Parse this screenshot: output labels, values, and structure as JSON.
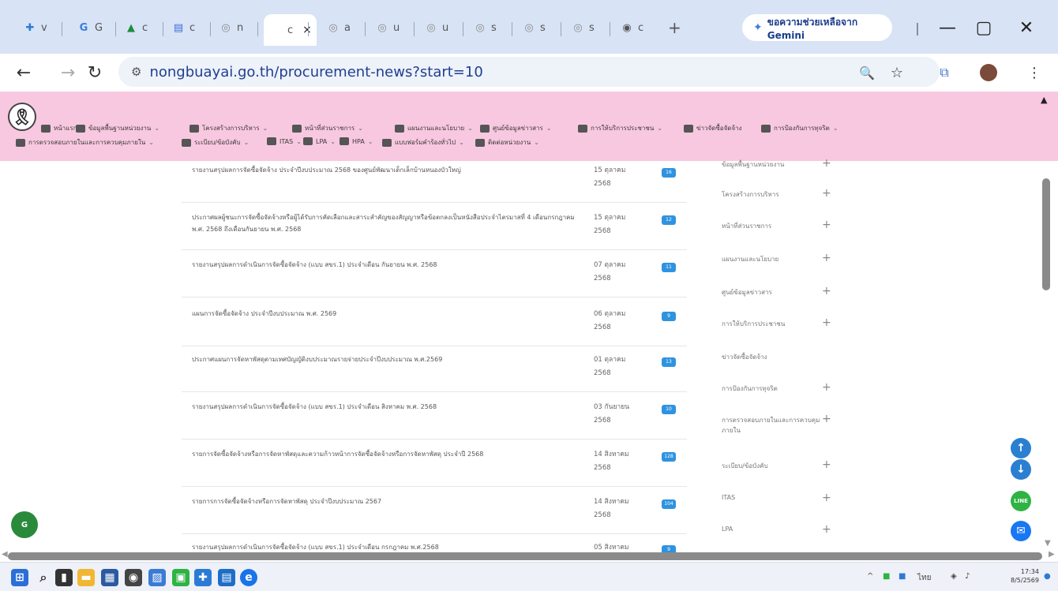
{
  "browser": {
    "tabs": [
      {
        "label": "v",
        "icon": "✚",
        "color": "#2b7bd4"
      },
      {
        "label": "G",
        "icon": "G",
        "color": "#3b7ddd"
      },
      {
        "label": "c",
        "icon": "▲",
        "color": "#1e8e3e"
      },
      {
        "label": "c",
        "icon": "▤",
        "color": "#3d6fd9"
      },
      {
        "label": "n",
        "icon": "◎",
        "color": "#8a8a8a"
      },
      {
        "label": "c",
        "icon": "",
        "color": "#8a8a8a"
      },
      {
        "label": "a",
        "icon": "◎",
        "color": "#8a8a8a"
      },
      {
        "label": "u",
        "icon": "◎",
        "color": "#8a8a8a"
      },
      {
        "label": "u",
        "icon": "◎",
        "color": "#8a8a8a"
      },
      {
        "label": "s",
        "icon": "◎",
        "color": "#8a8a8a"
      },
      {
        "label": "s",
        "icon": "◎",
        "color": "#8a8a8a"
      },
      {
        "label": "s",
        "icon": "◎",
        "color": "#8a8a8a"
      },
      {
        "label": "c",
        "icon": "◉",
        "color": "#555555"
      }
    ],
    "close_tab_glyph": "×",
    "new_tab_glyph": "+",
    "gemini_label": "ขอความช่วยเหลือจาก Gemini",
    "url": "nongbuayai.go.th/procurement-news?start=10"
  },
  "site_nav": {
    "row1": [
      {
        "label": "หน้าแรก",
        "caret": false
      },
      {
        "label": "ข้อมูลพื้นฐานหน่วยงาน",
        "caret": true
      },
      {
        "label": "โครงสร้างการบริหาร",
        "caret": true
      },
      {
        "label": "หน้าที่ส่วนราชการ",
        "caret": true
      },
      {
        "label": "แผนงานและนโยบาย",
        "caret": true
      },
      {
        "label": "ศูนย์ข้อมูลข่าวสาร",
        "caret": true
      },
      {
        "label": "การให้บริการประชาชน",
        "caret": true
      },
      {
        "label": "ข่าวจัดซื้อจัดจ้าง",
        "caret": false
      },
      {
        "label": "การป้องกันการทุจริต",
        "caret": true
      }
    ],
    "row2": [
      {
        "label": "การตรวจสอบภายในและการควบคุมภายใน",
        "caret": true
      },
      {
        "label": "ระเบียบ/ข้อบังคับ",
        "caret": true
      },
      {
        "label": "ITAS",
        "caret": true
      },
      {
        "label": "LPA",
        "caret": true
      },
      {
        "label": "HPA",
        "caret": true
      },
      {
        "label": "แบบฟอร์มคำร้องทั่วไป",
        "caret": true
      },
      {
        "label": "ติดต่อหน่วยงาน",
        "caret": true
      }
    ]
  },
  "news": [
    {
      "title": "รายงานสรุปผลการจัดซื้อจัดจ้าง ประจำปีงบประมาณ 2568 ของศูนย์พัฒนาเด็กเล็กบ้านหนองบัวใหญ่",
      "date": "15 ตุลาคม 2568",
      "badge": "16"
    },
    {
      "title": "ประกาศผลผู้ชนะการจัดซื้อจัดจ้างหรือผู้ได้รับการคัดเลือกและสาระสำคัญของสัญญาหรือข้อตกลงเป็นหนังสือประจำไตรมาสที่ 4 เดือนกรกฎาคม พ.ศ. 2568 ถึงเดือนกันยายน พ.ศ. 2568",
      "date": "15 ตุลาคม 2568",
      "badge": "12"
    },
    {
      "title": "รายงานสรุปผลการดำเนินการจัดซื้อจัดจ้าง (แบบ สขร.1) ประจำเดือน กันยายน พ.ศ. 2568",
      "date": "07 ตุลาคม 2568",
      "badge": "11"
    },
    {
      "title": "แผนการจัดซื้อจัดจ้าง ประจำปีงบประมาณ พ.ศ. 2569",
      "date": "06 ตุลาคม 2568",
      "badge": "9"
    },
    {
      "title": "ประกาศแผนการจัดหาพัสดุตามเทศบัญญัติงบประมาณรายจ่ายประจำปีงบประมาณ พ.ศ.2569",
      "date": "01 ตุลาคม 2568",
      "badge": "13"
    },
    {
      "title": "รายงานสรุปผลการดำเนินการจัดซื้อจัดจ้าง (แบบ สขร.1) ประจำเดือน สิงหาคม พ.ศ. 2568",
      "date": "03 กันยายน 2568",
      "badge": "10"
    },
    {
      "title": "รายการจัดซื้อจัดจ้างหรือการจัดหาพัสดุและความก้าวหน้าการจัดซื้อจัดจ้างหรือการจัดหาพัสดุ ประจำปี 2568",
      "date": "14 สิงหาคม 2568",
      "badge": "128"
    },
    {
      "title": "รายการการจัดซื้อจัดจ้างหรือการจัดหาพัสดุ ประจำปีงบประมาณ 2567",
      "date": "14 สิงหาคม 2568",
      "badge": "104"
    },
    {
      "title": "รายงานสรุปผลการดำเนินการจัดซื้อจัดจ้าง (แบบ สขร.1) ประจำเดือน กรกฎาคม พ.ศ.2568",
      "date": "05 สิงหาคม",
      "badge": "9"
    }
  ],
  "sidebar": [
    {
      "label": "ข้อมูลพื้นฐานหน่วยงาน",
      "plus": true
    },
    {
      "label": "โครงสร้างการบริหาร",
      "plus": true
    },
    {
      "label": "หน้าที่ส่วนราชการ",
      "plus": true
    },
    {
      "label": "แผนงานและนโยบาย",
      "plus": true
    },
    {
      "label": "ศูนย์ข้อมูลข่าวสาร",
      "plus": true
    },
    {
      "label": "การให้บริการประชาชน",
      "plus": true
    },
    {
      "label": "ข่าวจัดซื้อจัดจ้าง",
      "plus": false
    },
    {
      "label": "การป้องกันการทุจริต",
      "plus": true
    },
    {
      "label": "การตรวจสอบภายในและการควบคุมภายใน",
      "plus": true
    },
    {
      "label": "ระเบียบ/ข้อบังคับ",
      "plus": true
    },
    {
      "label": "ITAS",
      "plus": true
    },
    {
      "label": "LPA",
      "plus": true
    }
  ],
  "floating": {
    "line_label": "LINE"
  },
  "taskbar": {
    "lang": "ไทย",
    "time": "17:34",
    "date": "8/5/2569"
  },
  "colors": {
    "tabstrip": "#d8e3f5",
    "pink_nav": "#f8c8e0",
    "badge": "#2f93e0"
  }
}
